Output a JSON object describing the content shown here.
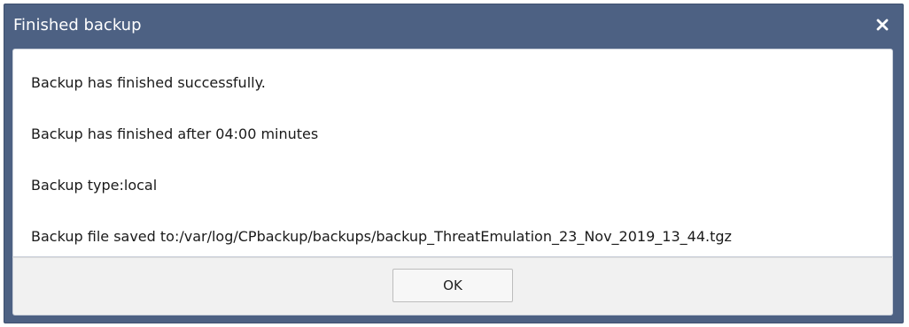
{
  "window": {
    "title": "Finished backup"
  },
  "icons": {
    "close": "close-icon"
  },
  "messages": {
    "line1": "Backup has finished successfully.",
    "line2": "Backup has finished after 04:00 minutes",
    "line3": "Backup type:local",
    "line4": "Backup file saved to:/var/log/CPbackup/backups/backup_ThreatEmulation_23_Nov_2019_13_44.tgz"
  },
  "buttons": {
    "ok_label": "OK"
  },
  "colors": {
    "titlebar": "#4d6183",
    "content_bg": "#ffffff",
    "footer_bg": "#f1f1f1"
  }
}
